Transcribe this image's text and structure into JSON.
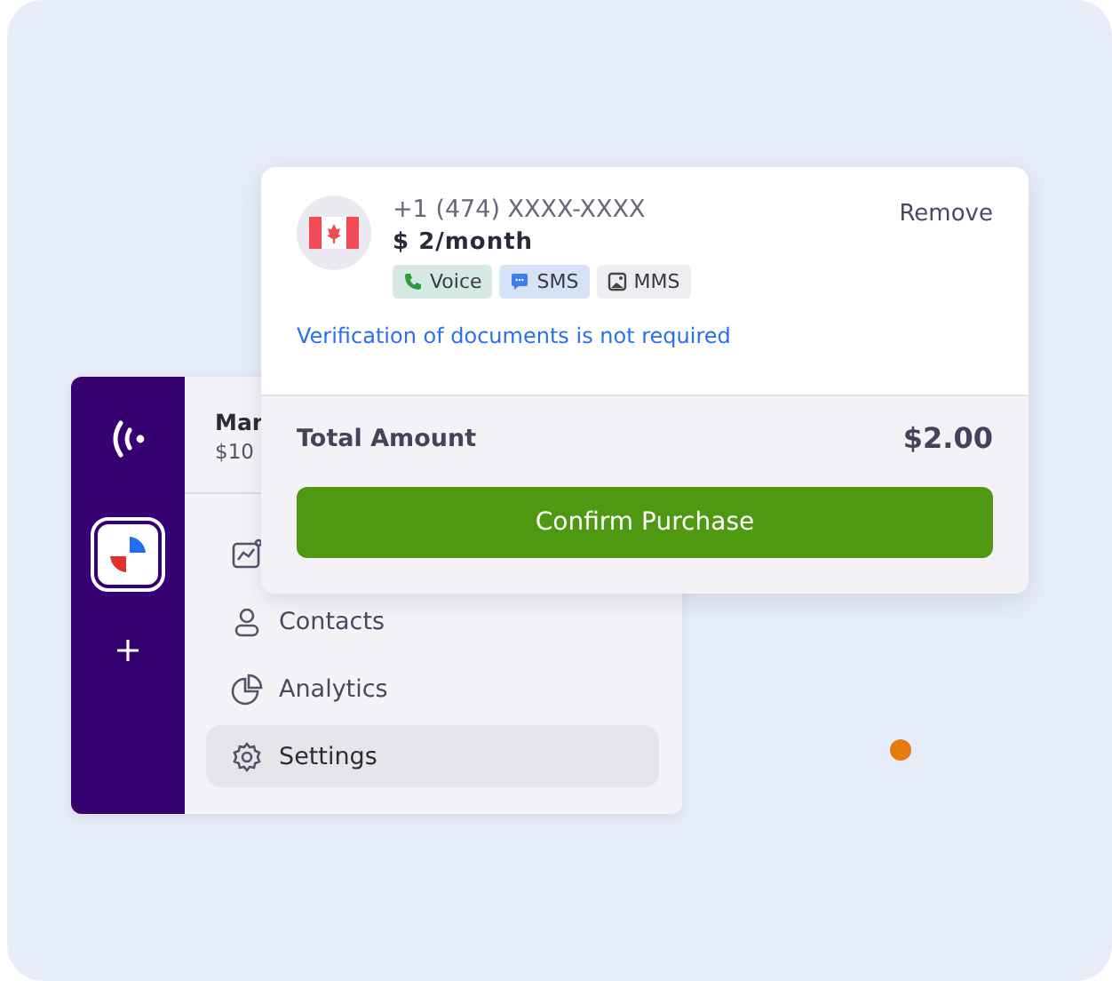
{
  "app": {
    "header": {
      "title": "Mar",
      "balance": "$10"
    },
    "rail": [
      {
        "kind": "logo"
      },
      {
        "kind": "workspace",
        "selected": true
      },
      {
        "kind": "add",
        "selected": false
      }
    ],
    "nav": [
      {
        "kind": "chart",
        "selected": false
      },
      {
        "kind": "contacts",
        "label": "Contacts",
        "selected": false
      },
      {
        "kind": "analytics",
        "label": "Analytics",
        "selected": false
      },
      {
        "kind": "settings",
        "label": "Settings",
        "selected": true
      }
    ]
  },
  "purchase": {
    "number": "+1 (474) XXXX-XXXX",
    "price": "$ 2/month",
    "remove": "Remove",
    "tags": [
      {
        "kind": "voice",
        "label": "Voice",
        "color": "#d3e9e2"
      },
      {
        "kind": "sms",
        "label": "SMS",
        "color": "#d6e3f7"
      },
      {
        "kind": "mms",
        "label": "MMS",
        "color": "#eeeef2"
      }
    ],
    "note": "Verification of documents is not required",
    "total_label": "Total Amount",
    "total": "$2.00",
    "confirm": "Confirm Purchase"
  }
}
